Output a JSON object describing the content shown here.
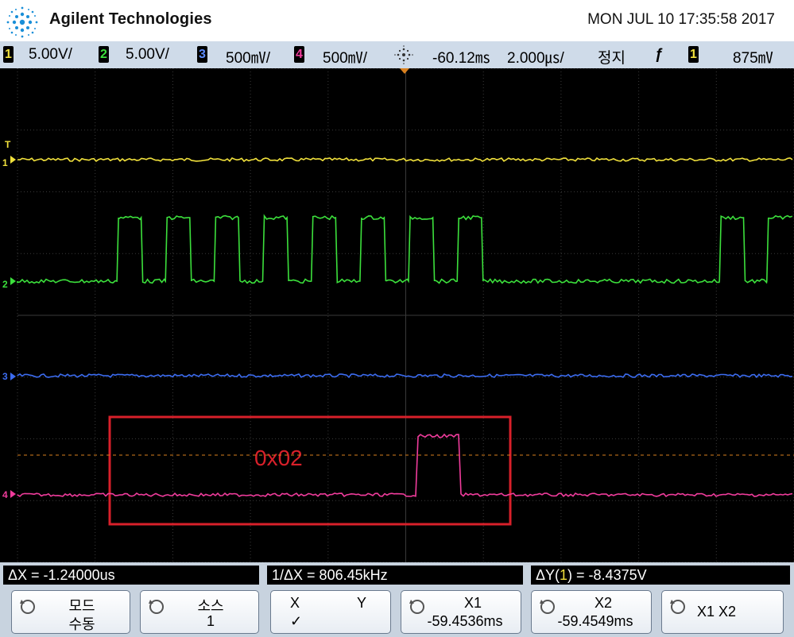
{
  "header": {
    "brand": "Agilent Technologies",
    "datetime": "MON JUL 10 17:35:58 2017"
  },
  "status": {
    "ch1": {
      "num": "1",
      "scale": "5.00V/",
      "color": "#f0e03c"
    },
    "ch2": {
      "num": "2",
      "scale": "5.00V/",
      "color": "#3ce03c"
    },
    "ch3": {
      "num": "3",
      "scale": "500㎷/",
      "color": "#3c6cf0"
    },
    "ch4": {
      "num": "4",
      "scale": "500㎷/",
      "color": "#f03c9c"
    },
    "delay": "-60.12㎳",
    "timebase": "2.000㎲/",
    "run_state": "정지",
    "trigger_edge": "ƒ",
    "trigger_source": "1",
    "trigger_level": "875㎷"
  },
  "screen": {
    "channel_markers": [
      "1",
      "2",
      "3",
      "4"
    ],
    "trigger_marker": "T",
    "annotation_text": "0x02",
    "annotation_color": "#d8202a"
  },
  "traces": {
    "ch2_level_sequence": [
      0,
      1,
      0,
      1,
      0,
      1,
      0,
      1,
      0,
      1,
      0,
      1,
      0,
      1,
      0,
      1,
      0,
      1,
      0,
      0,
      0,
      0,
      0,
      1,
      0,
      1
    ],
    "ch4_pulse_fraction": [
      0.51,
      0.57
    ]
  },
  "measurements": {
    "delta_x": "ΔX = -1.24000us",
    "inv_delta_x": "1/ΔX = 806.45kHz",
    "delta_y_prefix": "ΔY(",
    "delta_y_ch": "1",
    "delta_y_suffix": ") = -8.4375V"
  },
  "softkeys": {
    "mode_title": "모드",
    "mode_value": "수동",
    "source_title": "소스",
    "source_value": "1",
    "x_label": "X",
    "y_label": "Y",
    "check": "✓",
    "x1_title": "X1",
    "x1_value": "-59.4536ms",
    "x2_title": "X2",
    "x2_value": "-59.4549ms",
    "x1x2_label": "X1 X2"
  }
}
